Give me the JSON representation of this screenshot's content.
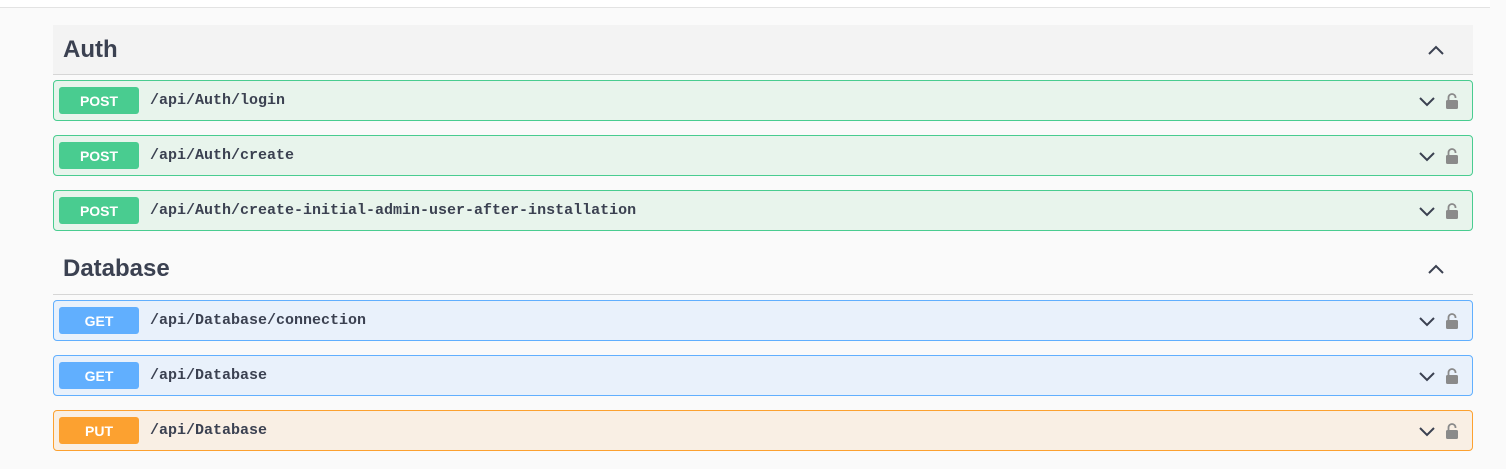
{
  "sections": [
    {
      "title": "Auth",
      "operations": [
        {
          "method": "POST",
          "path": "/api/Auth/login"
        },
        {
          "method": "POST",
          "path": "/api/Auth/create"
        },
        {
          "method": "POST",
          "path": "/api/Auth/create-initial-admin-user-after-installation"
        }
      ]
    },
    {
      "title": "Database",
      "operations": [
        {
          "method": "GET",
          "path": "/api/Database/connection"
        },
        {
          "method": "GET",
          "path": "/api/Database"
        },
        {
          "method": "PUT",
          "path": "/api/Database"
        }
      ]
    }
  ],
  "icons": {
    "collapse": "chevron-up-icon",
    "expand": "chevron-down-icon",
    "lock": "lock-icon"
  },
  "colors": {
    "post": "#49cc90",
    "get": "#61affe",
    "put": "#fca130",
    "text": "#3b4151"
  }
}
